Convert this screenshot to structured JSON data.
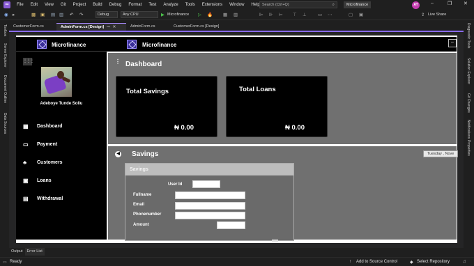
{
  "menubar": {
    "items": [
      "File",
      "Edit",
      "View",
      "Git",
      "Project",
      "Build",
      "Debug",
      "Format",
      "Test",
      "Analyze",
      "Tools",
      "Extensions",
      "Window",
      "Help"
    ],
    "search_placeholder": "Search (Ctrl+Q)",
    "solution_name": "Microfinance",
    "user_initials": "AT"
  },
  "toolbar": {
    "config": "Debug",
    "platform": "Any CPU",
    "run_target": "Microfinance",
    "live_share": "Live Share"
  },
  "left_tools": [
    "Toolbox",
    "Server Explorer",
    "Document Outline",
    "Data Sources"
  ],
  "right_tools": [
    "Diagnostic Tools",
    "Solution Explorer",
    "Git Changes",
    "Notifications",
    "Properties"
  ],
  "doc_tabs": [
    {
      "label": "CustomerForm.cs",
      "active": false
    },
    {
      "label": "AdminForm.cs [Design]",
      "active": true
    },
    {
      "label": "AdminForm.cs",
      "active": false
    },
    {
      "label": "CustomerForm.cs [Design]",
      "active": false
    }
  ],
  "form": {
    "app_title": "Microfinance",
    "header_title": "Microfinance",
    "profile_name": "Adeboye Tunde Soliu",
    "nav": [
      {
        "label": "Dashboard",
        "icon": "dashboard-icon",
        "glyph": "▦"
      },
      {
        "label": "Payment",
        "icon": "payment-icon",
        "glyph": "▭"
      },
      {
        "label": "Customers",
        "icon": "customers-icon",
        "glyph": "♣"
      },
      {
        "label": "Loans",
        "icon": "loans-icon",
        "glyph": "▣"
      },
      {
        "label": "Withdrawal",
        "icon": "withdrawal-icon",
        "glyph": "▤"
      }
    ],
    "dashboard": {
      "title": "Dashboard",
      "cards": [
        {
          "title": "Total Savings",
          "value": "₦ 0.00"
        },
        {
          "title": "Total Loans",
          "value": "₦ 0.00"
        }
      ]
    },
    "savings": {
      "title": "Savings",
      "date_value": "Tuesday , Nove",
      "box_title": "Savings",
      "fields": [
        "User Id",
        "Fullname",
        "Email",
        "Phonenumber",
        "Amount"
      ]
    }
  },
  "bottom_tabs": [
    "Output",
    "Error List"
  ],
  "status": {
    "ready": "Ready",
    "source_control": "Add to Source Control",
    "repository": "Select Repository"
  }
}
